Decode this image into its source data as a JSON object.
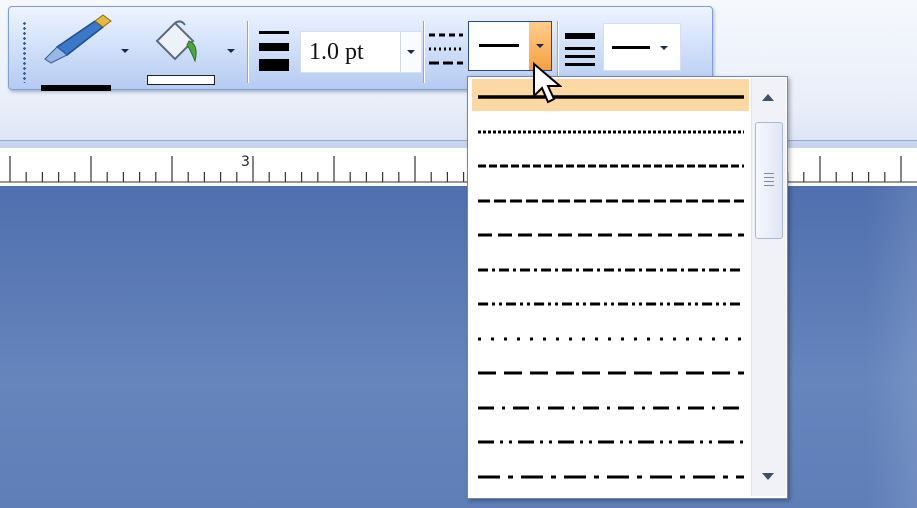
{
  "toolbar": {
    "line_weight_value": "1.0 pt",
    "line_color": "#000000",
    "fill_color": "#ffffff"
  },
  "ruler": {
    "label": "3"
  },
  "dash_style_dropdown": {
    "selected_index": 0,
    "items": [
      {
        "style": "solid"
      },
      {
        "style": "round-dot"
      },
      {
        "style": "square-dot"
      },
      {
        "style": "dash"
      },
      {
        "style": "dash-dot"
      },
      {
        "style": "long-dash"
      },
      {
        "style": "long-dash-dot"
      },
      {
        "style": "long-dash-dot-dot"
      },
      {
        "style": "sparse-dot"
      },
      {
        "style": "long-dash-sparse"
      },
      {
        "style": "dash-dot-sparse"
      },
      {
        "style": "dash-dot-dot-sparse"
      },
      {
        "style": "long-dash-dot-long"
      }
    ]
  },
  "colors": {
    "selection": "#fcd9a4",
    "dropdown_arrow_active": "#f6a141",
    "canvas": "#5f7eb8"
  }
}
